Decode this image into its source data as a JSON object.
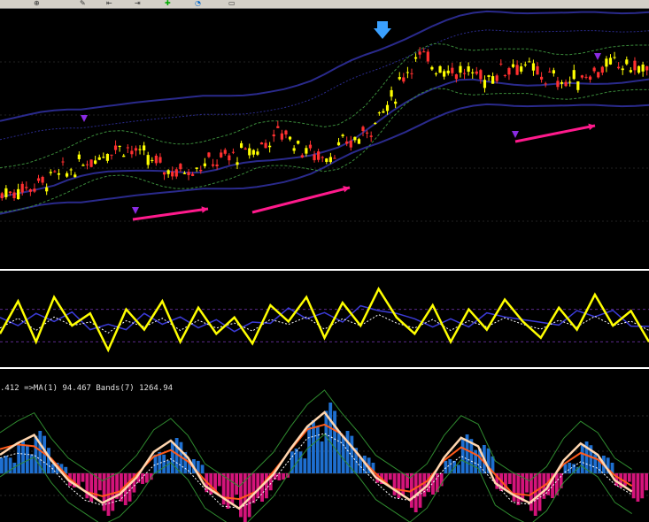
{
  "toolbar": {
    "icons": [
      "zoom-in-icon",
      "pencil-icon",
      "fit-icon",
      "scroll-icon",
      "new-order-icon",
      "history-icon",
      "terminal-icon"
    ]
  },
  "colors": {
    "background": "#000000",
    "candle": "#ffff00",
    "candle_down": "#ff3030",
    "bb_main": "#2a2a8c",
    "bb_inner": "#3a8a3a",
    "arrow_line": "#ff1a8c",
    "arrow_up_marker": "#8a2be2",
    "arrow_down_marker": "#3aa0ff",
    "rsi": "#ffff00",
    "rsi_signal": "#3b3bd6",
    "hist_pos": "#1e6fd0",
    "hist_neg": "#d4147a",
    "osc_line": "#ffd6b0",
    "osc_signal": "#ff5a1a",
    "osc_band": "#2f8a2f"
  },
  "indicator3": {
    "label": ".412 =>MA(1) 94.467 Bands(7) 1264.94"
  },
  "chart_data": [
    {
      "type": "line",
      "title": "",
      "series": [
        {
          "name": "",
          "values": [
            30,
            32,
            34,
            36,
            40,
            42,
            46,
            50,
            54,
            56,
            52,
            48,
            44,
            42,
            44,
            46,
            48,
            50,
            52,
            54,
            60,
            64,
            56,
            52,
            50,
            54,
            58,
            62,
            72,
            80,
            96,
            104,
            100,
            98,
            96,
            94,
            92,
            96,
            100,
            98,
            94,
            92,
            90,
            92,
            96,
            98,
            100,
            98,
            96
          ]
        }
      ]
    },
    {
      "type": "line",
      "title": "",
      "series": [
        {
          "name": "",
          "values": [
            40,
            80,
            30,
            85,
            50,
            65,
            20,
            70,
            45,
            80,
            30,
            72,
            40,
            60,
            28,
            75,
            55,
            85,
            35,
            78,
            50,
            95,
            60,
            40,
            75,
            30,
            70,
            45,
            82,
            55,
            35,
            72,
            45,
            88,
            50,
            68,
            30
          ]
        }
      ]
    },
    {
      "type": "bar",
      "title": "",
      "values": [
        5,
        9,
        12,
        3,
        -4,
        -8,
        -12,
        -9,
        -3,
        6,
        10,
        4,
        -6,
        -10,
        -14,
        -8,
        -2,
        7,
        15,
        20,
        12,
        5,
        -3,
        -7,
        -11,
        -6,
        4,
        11,
        8,
        -5,
        -9,
        -12,
        -7,
        3,
        9,
        5,
        -4,
        -8
      ]
    }
  ]
}
